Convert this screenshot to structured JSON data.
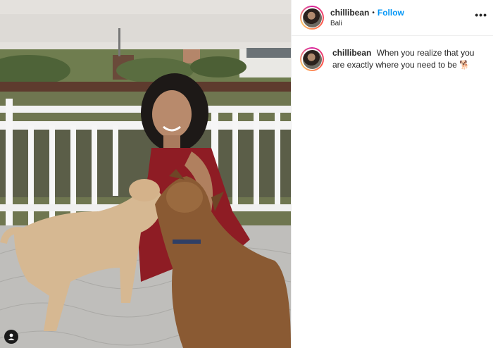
{
  "post": {
    "username": "chillibean",
    "separator": "•",
    "follow_label": "Follow",
    "location": "Bali",
    "more_icon": "more-options-icon",
    "caption": {
      "username": "chillibean",
      "text": "When you realize that you are exactly where you need to be",
      "emoji": "🐕"
    }
  },
  "photo": {
    "subject": "woman in red dress kneeling with two dogs on a balcony",
    "user_tag_icon": "user-tag-icon"
  }
}
